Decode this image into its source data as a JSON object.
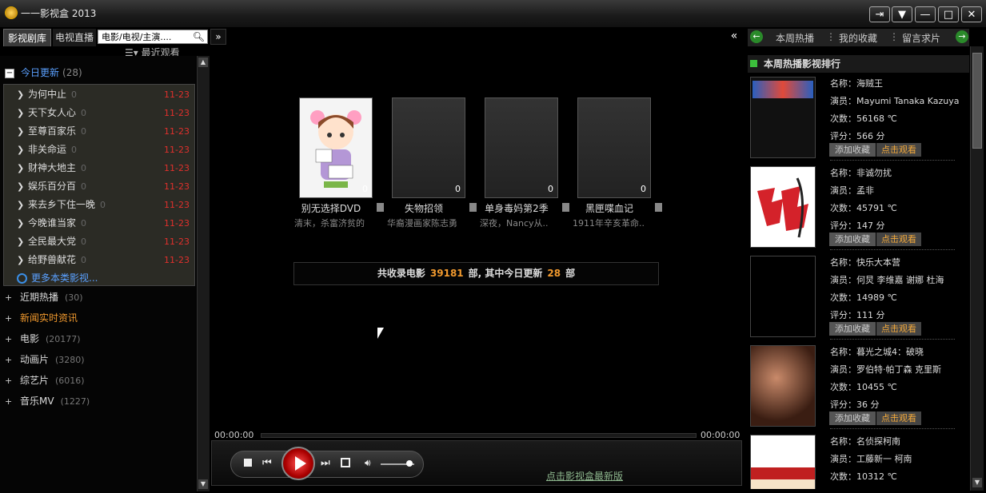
{
  "window": {
    "title": "一一影视盒 2013",
    "buttons": [
      "⇥",
      "▼",
      "—",
      "□",
      "✕"
    ]
  },
  "left": {
    "tabs": [
      "影视剧库",
      "电视直播"
    ],
    "search_value": "电影/电视/主演....",
    "expand_label": "»",
    "recent_label": "☰▾ 最近观看",
    "today": {
      "label": "今日更新",
      "count": "(28)",
      "items": [
        {
          "name": "为何中止",
          "count": "0",
          "date": "11-23"
        },
        {
          "name": "天下女人心",
          "count": "0",
          "date": "11-23"
        },
        {
          "name": "至尊百家乐",
          "count": "0",
          "date": "11-23"
        },
        {
          "name": "非关命运",
          "count": "0",
          "date": "11-23"
        },
        {
          "name": "财神大地主",
          "count": "0",
          "date": "11-23"
        },
        {
          "name": "娱乐百分百",
          "count": "0",
          "date": "11-23"
        },
        {
          "name": "来去乡下住一晚",
          "count": "0",
          "date": "11-23"
        },
        {
          "name": "今晚谁当家",
          "count": "0",
          "date": "11-23"
        },
        {
          "name": "全民最大党",
          "count": "0",
          "date": "11-23"
        },
        {
          "name": "给野兽献花",
          "count": "0",
          "date": "11-23"
        }
      ],
      "more_label": "更多本类影视..."
    },
    "categories": [
      {
        "name": "近期热播",
        "count": "(30)",
        "highlight": false
      },
      {
        "name": "新闻实时资讯",
        "count": "",
        "highlight": true
      },
      {
        "name": "电影",
        "count": "(20177)",
        "highlight": false
      },
      {
        "name": "动画片",
        "count": "(3280)",
        "highlight": false
      },
      {
        "name": "综艺片",
        "count": "(6016)",
        "highlight": false
      },
      {
        "name": "音乐MV",
        "count": "(1227)",
        "highlight": false
      }
    ]
  },
  "center": {
    "collapse_label": "«",
    "cards": [
      {
        "title": "别无选择DVD",
        "count": "0",
        "desc": "清末，杀富济贫的"
      },
      {
        "title": "失物招领",
        "count": "0",
        "desc": "华裔漫画家陈志勇"
      },
      {
        "title": "单身毒妈第2季",
        "count": "0",
        "desc": "深夜，Nancy从.."
      },
      {
        "title": "黑匣喋血记",
        "count": "0",
        "desc": "1911年辛亥革命.."
      }
    ],
    "summary": {
      "prefix": "共收录电影",
      "total": "39181",
      "middle": "部, 其中今日更新",
      "today": "28",
      "suffix": "部"
    }
  },
  "player": {
    "time_current": "00:00:00",
    "time_total": "00:00:00",
    "progress": 0,
    "volume": 0.85,
    "update_link": "点击影视盒最新版"
  },
  "right": {
    "tabs": [
      "本周热播",
      "我的收藏",
      "留言求片"
    ],
    "section_title": "本周热播影视排行",
    "labels": {
      "name": "名称：",
      "actor": "演员：",
      "plays": "次数：",
      "score": "评分：",
      "plays_unit": "℃",
      "score_unit": "分",
      "fav_button": "添加收藏",
      "watch_button": "点击观看"
    },
    "items": [
      {
        "name": "海贼王",
        "actor": "Mayumi Tanaka Kazuya",
        "plays": "56168",
        "score": "566"
      },
      {
        "name": "非诚勿扰",
        "actor": "孟非",
        "plays": "45791",
        "score": "147"
      },
      {
        "name": "快乐大本营",
        "actor": "何炅 李维嘉 谢娜 杜海",
        "plays": "14989",
        "score": "111"
      },
      {
        "name": "暮光之城4：破晓",
        "actor": "罗伯特·帕丁森 克里斯",
        "plays": "10455",
        "score": "36"
      },
      {
        "name": "名侦探柯南",
        "actor": "工藤新一 柯南",
        "plays": "10312",
        "score": ""
      }
    ]
  },
  "colors": {
    "date_red": "#e0302c",
    "highlight_orange": "#f29a2e",
    "green_accent": "#3cbf3c",
    "today_blue": "#5aa0ff"
  }
}
